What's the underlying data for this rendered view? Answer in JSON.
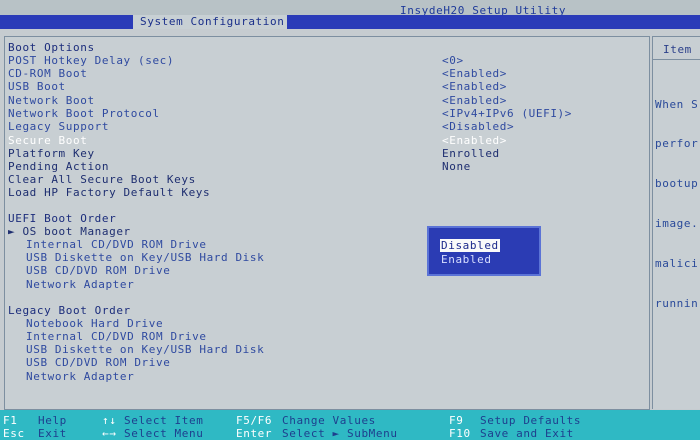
{
  "app_title": "InsydeH20 Setup Utility",
  "active_tab": "System Configuration",
  "side": {
    "header": "Item",
    "help_lines": [
      "When S",
      "perfor",
      "bootup",
      "image.",
      "malici",
      "runnin"
    ]
  },
  "boot_options": {
    "header": "Boot Options",
    "items": [
      {
        "label": "POST Hotkey Delay (sec)",
        "value": "<0>"
      },
      {
        "label": "CD-ROM Boot",
        "value": "<Enabled>"
      },
      {
        "label": "USB Boot",
        "value": "<Enabled>"
      },
      {
        "label": "Network Boot",
        "value": "<Enabled>"
      },
      {
        "label": "Network Boot Protocol",
        "value": "<IPv4+IPv6 (UEFI)>"
      },
      {
        "label": "Legacy Support",
        "value": "<Disabled>"
      },
      {
        "label": "Secure Boot",
        "value": "<Enabled>"
      },
      {
        "label": "Platform Key",
        "value": "Enrolled"
      },
      {
        "label": "Pending Action",
        "value": "None"
      },
      {
        "label": "Clear All Secure Boot Keys",
        "value": ""
      },
      {
        "label": "Load HP Factory Default Keys",
        "value": ""
      }
    ]
  },
  "uefi_boot_order": {
    "header": "UEFI Boot Order",
    "group": "► OS boot Manager",
    "items": [
      "Internal CD/DVD ROM Drive",
      "USB Diskette on Key/USB Hard Disk",
      "USB CD/DVD ROM Drive",
      "Network Adapter"
    ]
  },
  "legacy_boot_order": {
    "header": "Legacy Boot Order",
    "items": [
      "Notebook Hard Drive",
      "Internal CD/DVD ROM Drive",
      "USB Diskette on Key/USB Hard Disk",
      "USB CD/DVD ROM Drive",
      "Network Adapter"
    ]
  },
  "popup": {
    "options": [
      "Disabled",
      "Enabled"
    ],
    "selected": "Disabled"
  },
  "footer": [
    {
      "key": "F1",
      "desc": "Help"
    },
    {
      "key": "Esc",
      "desc": "Exit"
    },
    {
      "key": "↑↓",
      "desc": "Select Item"
    },
    {
      "key": "←→",
      "desc": "Select Menu"
    },
    {
      "key": "F5/F6",
      "desc": "Change Values"
    },
    {
      "key": "Enter",
      "desc": "Select ► SubMenu"
    },
    {
      "key": "F9",
      "desc": "Setup Defaults"
    },
    {
      "key": "F10",
      "desc": "Save and Exit"
    }
  ]
}
